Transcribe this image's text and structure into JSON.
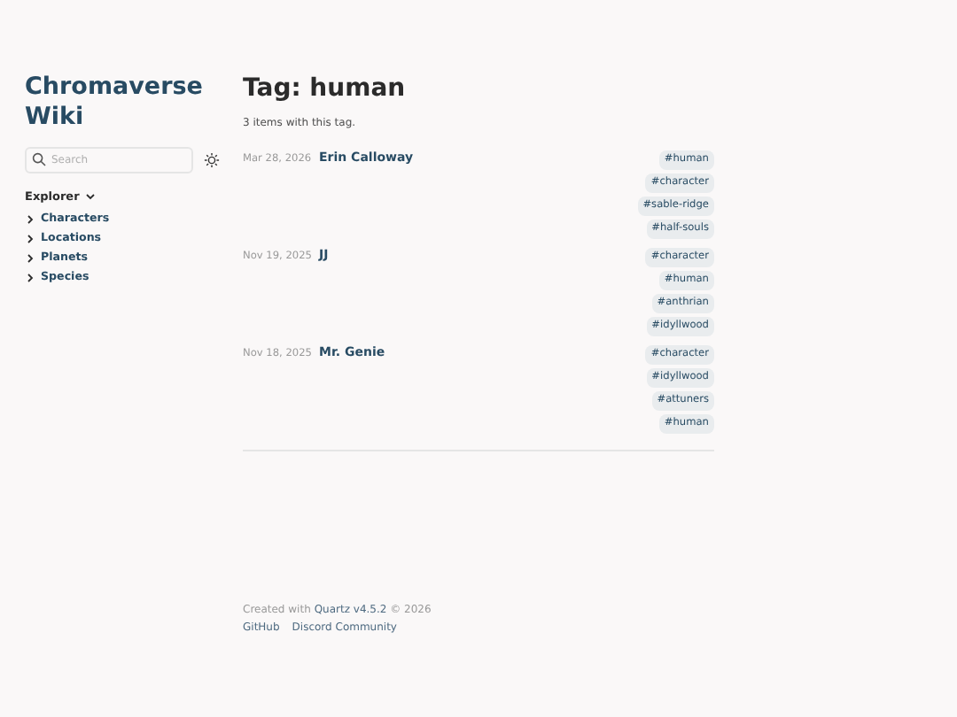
{
  "sidebar": {
    "title": "Chromaverse Wiki",
    "search": {
      "placeholder": "Search"
    },
    "explorer": {
      "label": "Explorer",
      "expanded": true,
      "items": [
        {
          "label": "Characters",
          "expanded": false
        },
        {
          "label": "Locations",
          "expanded": false
        },
        {
          "label": "Planets",
          "expanded": false
        },
        {
          "label": "Species",
          "expanded": false
        }
      ]
    }
  },
  "main": {
    "title": "Tag: human",
    "summary": "3 items with this tag.",
    "items": [
      {
        "date": "Mar 28, 2026",
        "title": "Erin Calloway",
        "tags": [
          "#human",
          "#character",
          "#sable-ridge",
          "#half-souls"
        ]
      },
      {
        "date": "Nov 19, 2025",
        "title": "JJ",
        "tags": [
          "#character",
          "#human",
          "#anthrian",
          "#idyllwood"
        ]
      },
      {
        "date": "Nov 18, 2025",
        "title": "Mr. Genie",
        "tags": [
          "#character",
          "#idyllwood",
          "#attuners",
          "#human"
        ]
      }
    ]
  },
  "footer": {
    "prefix": "Created with",
    "link": "Quartz v4.5.2",
    "suffix": "© 2026",
    "links": [
      "GitHub",
      "Discord Community"
    ]
  }
}
